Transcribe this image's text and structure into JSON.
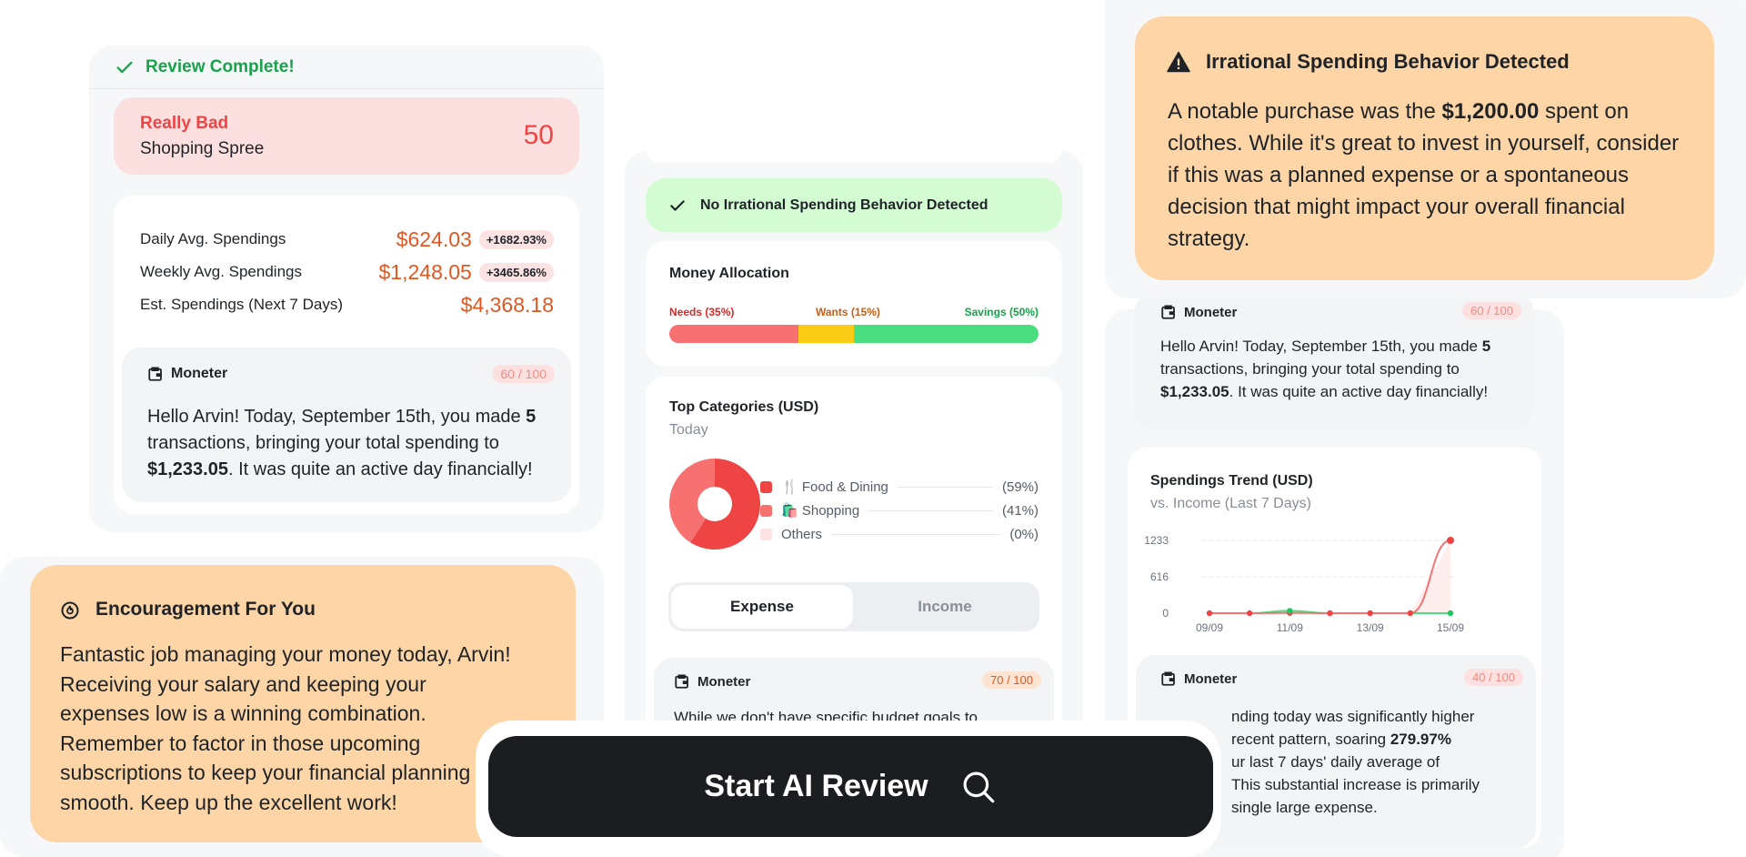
{
  "review_panel": {
    "status": "Review Complete!",
    "rating": {
      "label": "Really Bad",
      "title": "Shopping Spree",
      "score": "50"
    },
    "stats": [
      {
        "label": "Daily Avg. Spendings",
        "value": "$624.03",
        "change": "+1682.93%"
      },
      {
        "label": "Weekly Avg. Spendings",
        "value": "$1,248.05",
        "change": "+3465.86%"
      },
      {
        "label": "Est. Spendings (Next 7 Days)",
        "value": "$4,368.18",
        "change": ""
      }
    ],
    "moneter": {
      "name": "Moneter",
      "score": "60 / 100",
      "t1": "Hello Arvin! Today, September 15th, you made ",
      "b1": "5",
      "t2": " transactions, bringing your total spending to ",
      "b2": "$1,233.05",
      "t3": ". It was quite an active day financially!"
    }
  },
  "encouragement": {
    "title": "Encouragement For You",
    "text": "Fantastic job managing your money today, Arvin! Receiving your salary and keeping your expenses low is a winning combination. Remember to factor in those upcoming subscriptions to keep your financial planning smooth. Keep up the excellent work!"
  },
  "center_panel": {
    "no_irrational": "No Irrational Spending Behavior Detected",
    "allocation": {
      "title": "Money Allocation",
      "needs": "Needs (35%)",
      "wants": "Wants (15%)",
      "savings": "Savings (50%)",
      "needs_pct": 35,
      "wants_pct": 15,
      "savings_pct": 50
    },
    "top_categories": {
      "title": "Top Categories (USD)",
      "subtitle": "Today",
      "items": [
        {
          "label": "🍴 Food & Dining",
          "pct": "(59%)",
          "value": 59,
          "color": "#ef4444"
        },
        {
          "label": "🛍️ Shopping",
          "pct": "(41%)",
          "value": 41,
          "color": "#f87171"
        },
        {
          "label": "Others",
          "pct": "(0%)",
          "value": 0,
          "color": "#fde2e2"
        }
      ]
    },
    "tabs": {
      "expense": "Expense",
      "income": "Income"
    },
    "moneter": {
      "name": "Moneter",
      "score": "70 / 100",
      "text": "While we don't have specific budget goals to"
    }
  },
  "irrational": {
    "title": "Irrational Spending Behavior Detected",
    "t1": "A notable purchase was the ",
    "b1": "$1,200.00",
    "t2": " spent on clothes. While it's great to invest in yourself, consider if this was a planned expense or a spontaneous decision that might impact your overall financial strategy."
  },
  "right_panel": {
    "moneter_top": {
      "name": "Moneter",
      "score": "60 / 100",
      "t1": "Hello Arvin! Today, September 15th, you made ",
      "b1": "5",
      "t2": " transactions, bringing your total spending to ",
      "b2": "$1,233.05",
      "t3": ". It was quite an active day financially!"
    },
    "trend": {
      "title": "Spendings Trend (USD)",
      "subtitle": "vs. Income (Last 7 Days)"
    },
    "moneter_bottom": {
      "name": "Moneter",
      "score": "40 / 100",
      "l1a": "nding today was significantly higher",
      "l2a": " recent pattern, soaring ",
      "l2b": "279.97%",
      "l3a": "ur last 7 days' daily average of",
      "l4a": "This substantial increase is primarily",
      "l5a": "single large expense."
    }
  },
  "cta": {
    "label": "Start AI Review"
  },
  "colors": {
    "needs": "#f87171",
    "wants": "#facc15",
    "savings": "#4ade80",
    "expense_line": "#f87171",
    "income_line": "#4ade80",
    "orange_card": "#fdd5a6",
    "bad_card": "#fce0df",
    "success_green": "#16a34a"
  },
  "chart_data": {
    "type": "line",
    "title": "Spendings Trend (USD)",
    "subtitle": "vs. Income (Last 7 Days)",
    "x": [
      "09/09",
      "10/09",
      "11/09",
      "12/09",
      "13/09",
      "14/09",
      "15/09"
    ],
    "x_tick_labels": [
      "09/09",
      "11/09",
      "13/09",
      "15/09"
    ],
    "y_ticks": [
      "0",
      "616",
      "1233"
    ],
    "ylim": [
      0,
      1233
    ],
    "series": [
      {
        "values": [
          0,
          0,
          5,
          0,
          0,
          0,
          1233
        ],
        "color": "#f87171"
      },
      {
        "values": [
          0,
          0,
          40,
          0,
          0,
          0,
          0
        ],
        "color": "#4ade80"
      }
    ],
    "grid": true
  }
}
